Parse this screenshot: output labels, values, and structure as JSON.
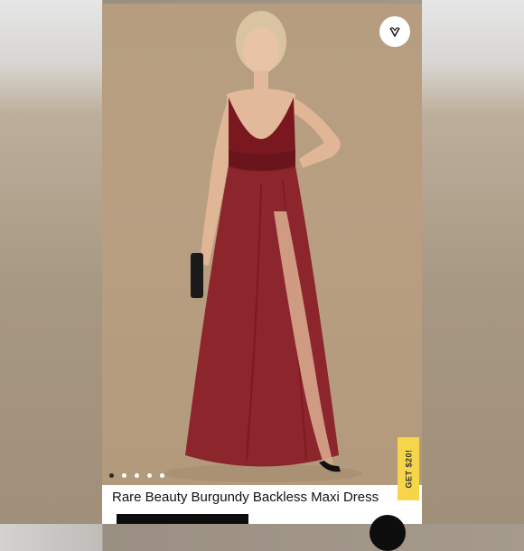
{
  "listing": {
    "title": "Rare Beauty Burgundy Backless Maxi Dress",
    "promo_label": "GET $20!",
    "carousel": {
      "total": 5,
      "active": 1
    },
    "like_icon": "heart-icon"
  },
  "colors": {
    "dress": "#7d1a22",
    "backdrop": "#b69d7f",
    "promo": "#f7d54a"
  }
}
